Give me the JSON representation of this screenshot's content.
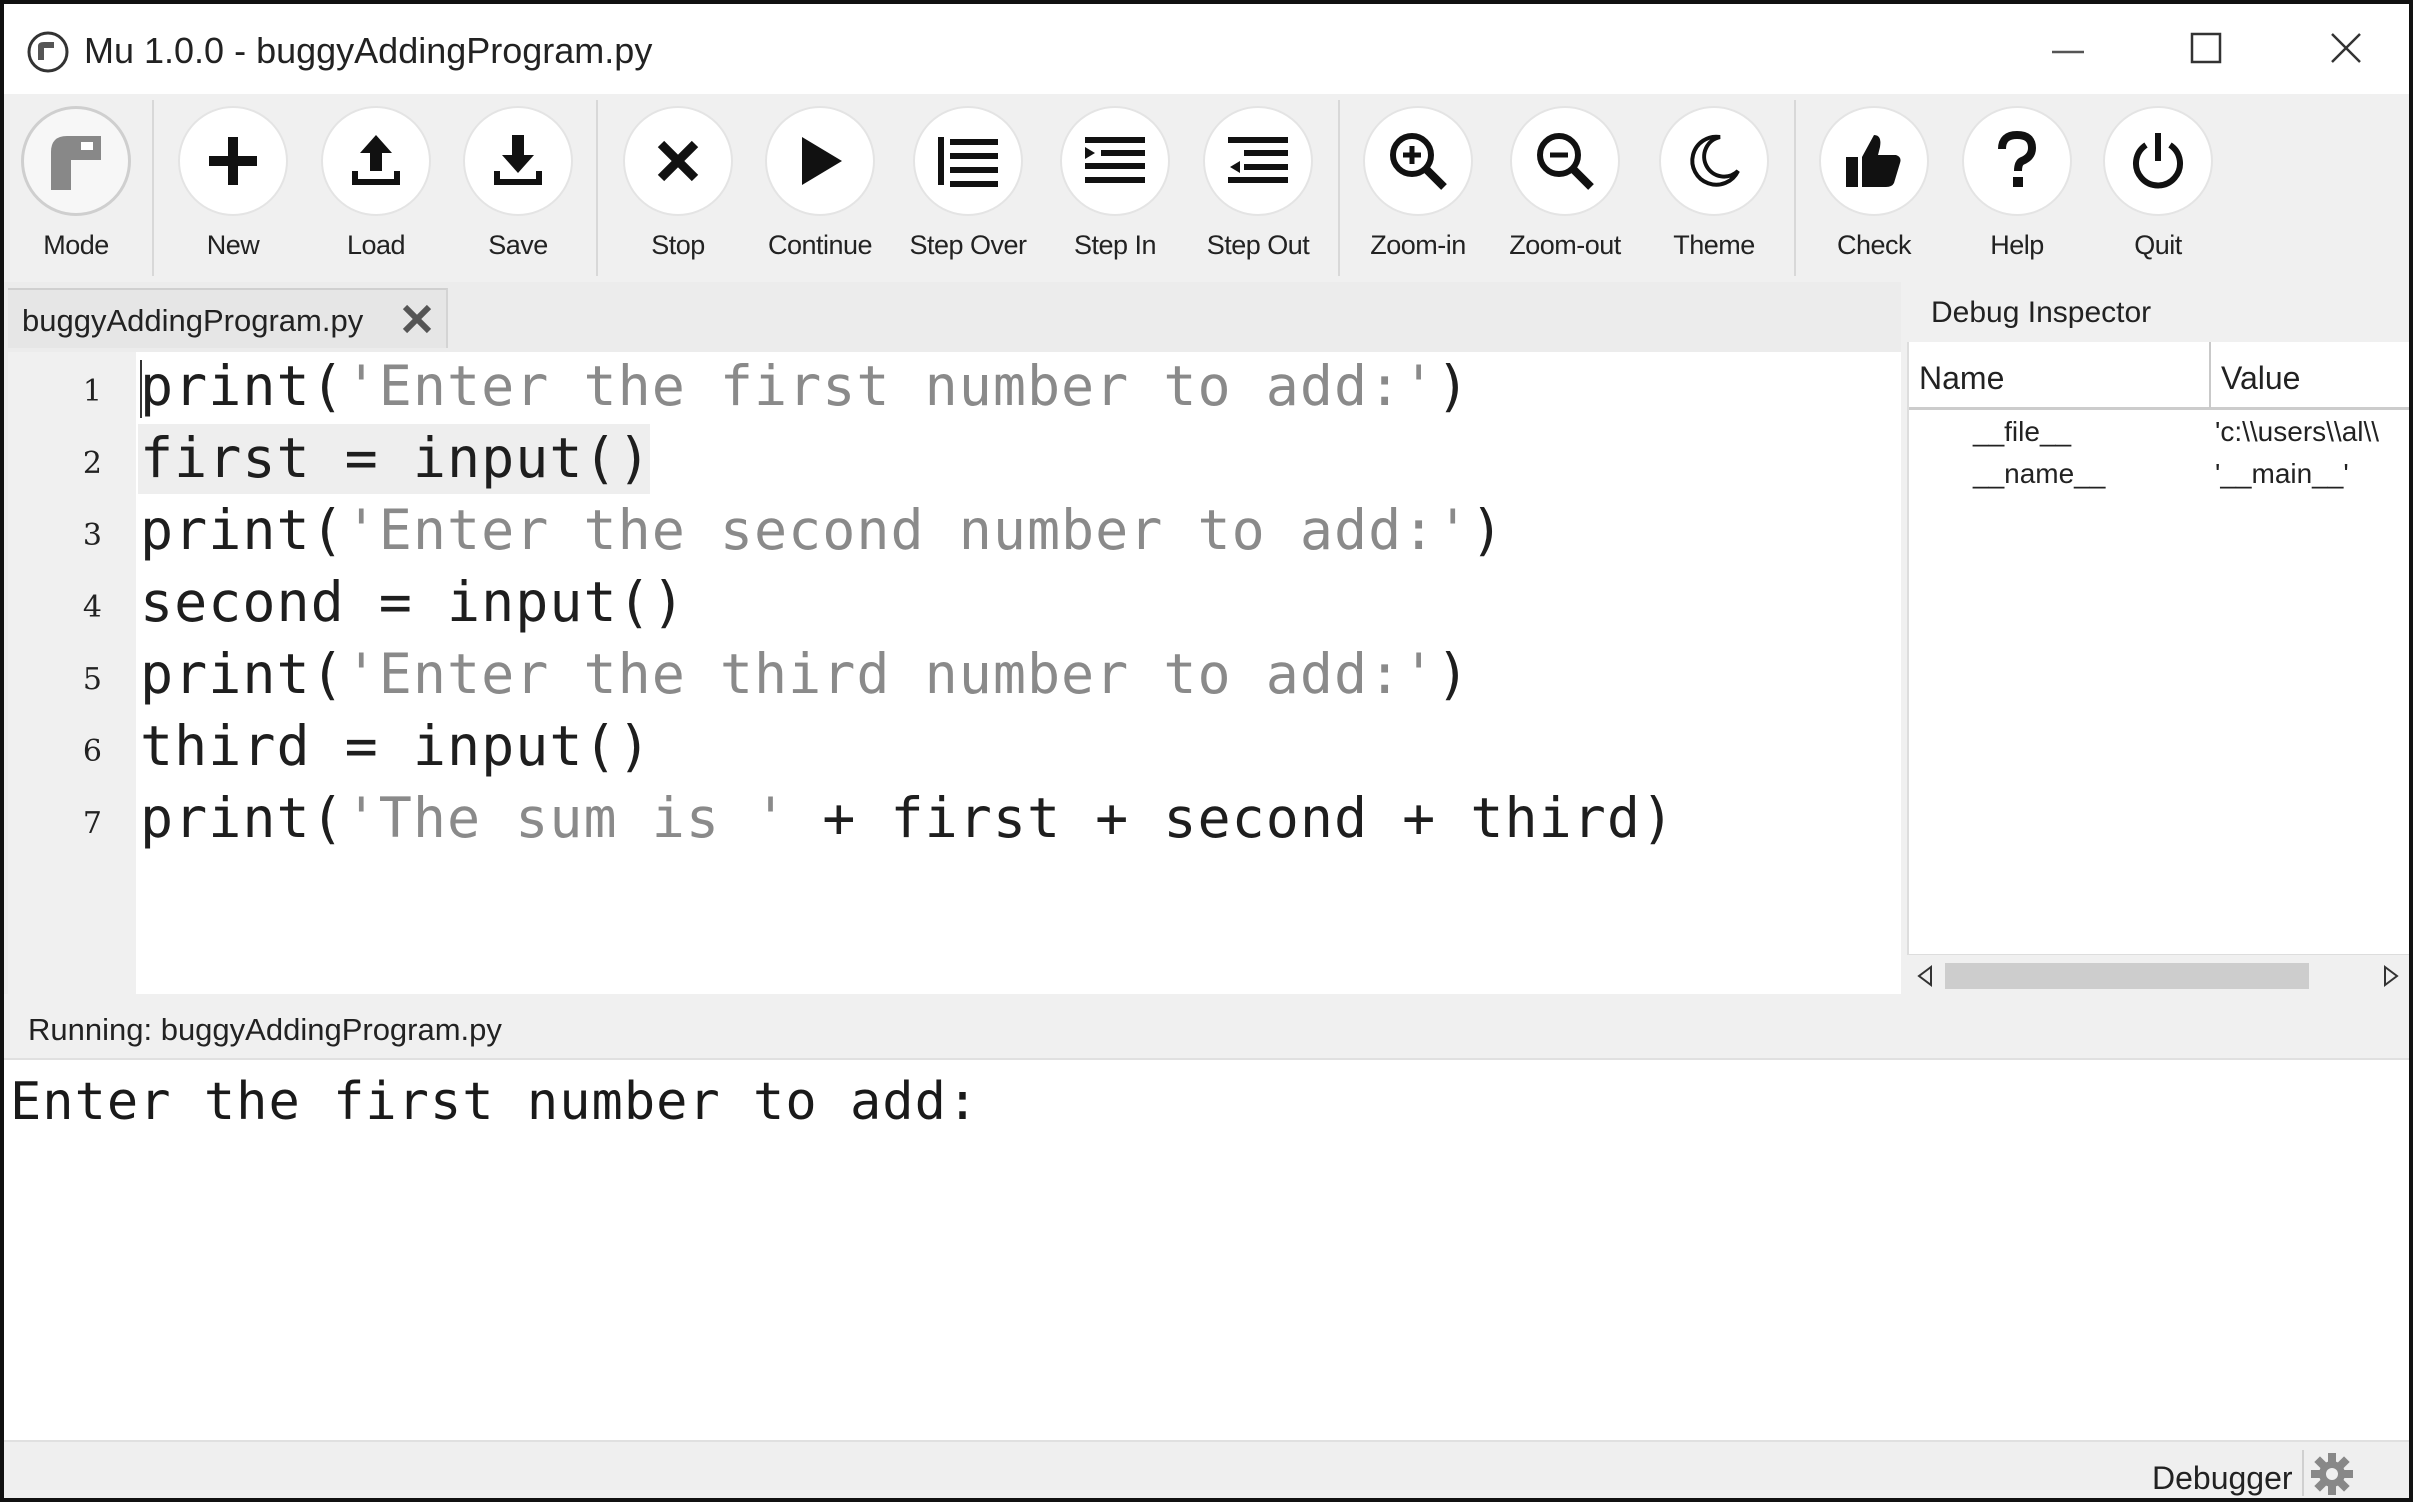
{
  "window": {
    "title": "Mu 1.0.0 - buggyAddingProgram.py",
    "icons": [
      "minimize-icon",
      "maximize-icon",
      "close-icon"
    ]
  },
  "toolbar": {
    "buttons": [
      {
        "label": "Mode",
        "icon": "mode-icon"
      },
      {
        "label": "New",
        "icon": "plus-icon"
      },
      {
        "label": "Load",
        "icon": "upload-icon"
      },
      {
        "label": "Save",
        "icon": "download-icon"
      },
      {
        "label": "Stop",
        "icon": "x-icon"
      },
      {
        "label": "Continue",
        "icon": "play-icon"
      },
      {
        "label": "Step Over",
        "icon": "step-over-icon"
      },
      {
        "label": "Step In",
        "icon": "step-in-icon"
      },
      {
        "label": "Step Out",
        "icon": "step-out-icon"
      },
      {
        "label": "Zoom-in",
        "icon": "zoom-in-icon"
      },
      {
        "label": "Zoom-out",
        "icon": "zoom-out-icon"
      },
      {
        "label": "Theme",
        "icon": "moon-icon"
      },
      {
        "label": "Check",
        "icon": "thumbs-up-icon"
      },
      {
        "label": "Help",
        "icon": "question-icon"
      },
      {
        "label": "Quit",
        "icon": "power-icon"
      }
    ]
  },
  "editor": {
    "tab_label": "buggyAddingProgram.py",
    "lines": [
      {
        "num": "1",
        "code_a": "print(",
        "str": "'Enter the first number to add:'",
        "code_b": ")"
      },
      {
        "num": "2",
        "code_a": "first = input()",
        "str": "",
        "code_b": ""
      },
      {
        "num": "3",
        "code_a": "print(",
        "str": "'Enter the second number to add:'",
        "code_b": ")"
      },
      {
        "num": "4",
        "code_a": "second = input()",
        "str": "",
        "code_b": ""
      },
      {
        "num": "5",
        "code_a": "print(",
        "str": "'Enter the third number to add:'",
        "code_b": ")"
      },
      {
        "num": "6",
        "code_a": "third = input()",
        "str": "",
        "code_b": ""
      },
      {
        "num": "7",
        "code_a": "print(",
        "str": "'The sum is '",
        "code_b": " + first + second + third)"
      }
    ]
  },
  "debug_inspector": {
    "title": "Debug Inspector",
    "columns": [
      "Name",
      "Value"
    ],
    "rows": [
      {
        "name": "__file__",
        "value": "'c:\\\\users\\\\al\\\\"
      },
      {
        "name": "__name__",
        "value": "'__main__'"
      }
    ]
  },
  "run_status": "Running: buggyAddingProgram.py",
  "repl_output": "Enter the first number to add:",
  "bottom_bar": {
    "mode": "Debugger",
    "icon": "gear-icon"
  },
  "colors": {
    "toolbar_bg": "#f0f0f0",
    "string_text": "#8a8a8a",
    "code_text": "#1e1e1e"
  }
}
